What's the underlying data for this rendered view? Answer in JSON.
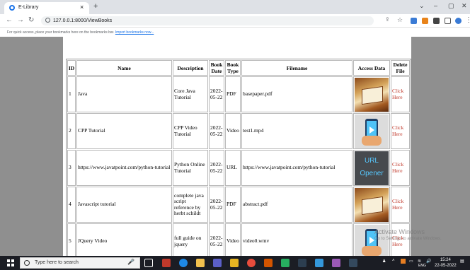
{
  "browser": {
    "tab_title": "E-Library",
    "tab_close": "×",
    "new_tab": "+",
    "url": "127.0.0.1:8000/ViewBooks",
    "bookmarks_text": "For quick access, place your bookmarks here on the bookmarks bar.",
    "bookmarks_link": "Import bookmarks now..."
  },
  "table": {
    "headers": [
      "ID",
      "Name",
      "Description",
      "Book Date",
      "Book Type",
      "Filename",
      "Access Data",
      "Delete File"
    ],
    "rows": [
      {
        "id": "1",
        "name": "Java",
        "description": "Core Java Tutorial",
        "date": "2022-05-22",
        "type": "PDF",
        "filename": "basepaper.pdf",
        "thumb": "book",
        "delete": "Click Here"
      },
      {
        "id": "2",
        "name": "CPP Tutorial",
        "description": "CPP Video Tutorial",
        "date": "2022-05-22",
        "type": "Video",
        "filename": "test1.mp4",
        "thumb": "video",
        "delete": "Click Here"
      },
      {
        "id": "3",
        "name": "https://www.javatpoint.com/python-tutorial",
        "description": "Python Online Tutorial",
        "date": "2022-05-22",
        "type": "URL",
        "filename": "https://www.javatpoint.com/python-tutorial",
        "thumb": "url",
        "thumb_text": "URL Opener",
        "delete": "Click Here"
      },
      {
        "id": "4",
        "name": "Javascript tutorial",
        "description": "complete java script reference by herbt schildt",
        "date": "2022-05-22",
        "type": "PDF",
        "filename": "abstract.pdf",
        "thumb": "book",
        "delete": "Click Here"
      },
      {
        "id": "5",
        "name": "JQuery Video",
        "description": "full guide on jquery",
        "date": "2022-05-22",
        "type": "Video",
        "filename": "video0.wmv",
        "thumb": "video",
        "delete": "Click Here"
      }
    ]
  },
  "watermark": {
    "title": "Activate Windows",
    "subtitle": "Go to Settings to activate Windows."
  },
  "taskbar": {
    "search_placeholder": "Type here to search",
    "time": "15:24",
    "date": "22-05-2022",
    "lang": "ENG"
  }
}
